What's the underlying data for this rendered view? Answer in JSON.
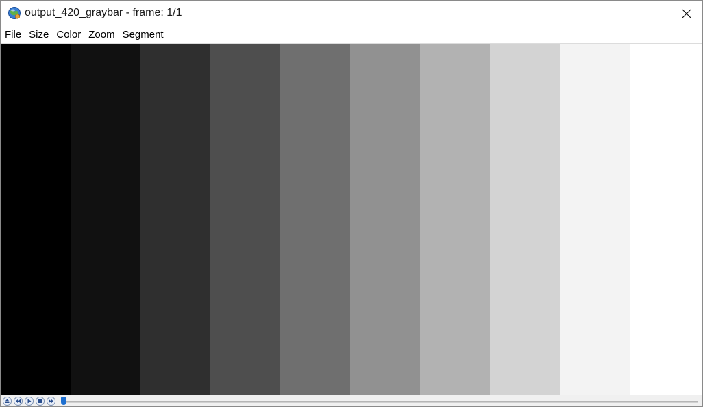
{
  "window": {
    "title": "output_420_graybar - frame: 1/1",
    "app_icon": "globe-app-icon",
    "close_icon": "close-icon"
  },
  "menubar": {
    "items": [
      "File",
      "Size",
      "Color",
      "Zoom",
      "Segment"
    ]
  },
  "canvas": {
    "bars": [
      {
        "color": "#000000"
      },
      {
        "color": "#111111"
      },
      {
        "color": "#2f2f2f"
      },
      {
        "color": "#4e4e4e"
      },
      {
        "color": "#6f6f6f"
      },
      {
        "color": "#919191"
      },
      {
        "color": "#b2b2b2"
      },
      {
        "color": "#d3d3d3"
      },
      {
        "color": "#f3f3f3"
      },
      {
        "color": "#ffffff"
      }
    ]
  },
  "controls": {
    "buttons": [
      "eject-icon",
      "rewind-icon",
      "play-icon",
      "stop-icon",
      "fast-forward-icon"
    ],
    "slider_position": 0.0,
    "accent": "#1e6fd0"
  }
}
